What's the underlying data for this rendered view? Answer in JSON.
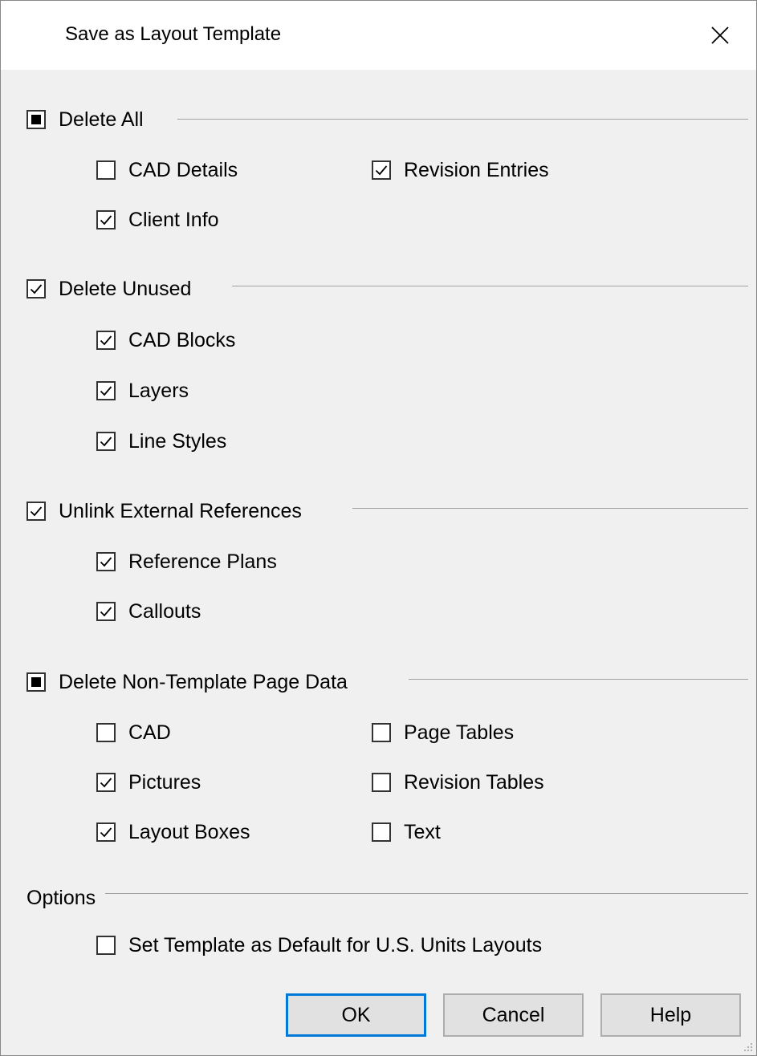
{
  "window": {
    "title": "Save as Layout Template"
  },
  "groups": {
    "delete_all": {
      "label": "Delete All",
      "state": "indeterminate",
      "items": {
        "cad_details": {
          "label": "CAD Details",
          "checked": false
        },
        "revision_entries": {
          "label": "Revision Entries",
          "checked": true
        },
        "client_info": {
          "label": "Client Info",
          "checked": true
        }
      }
    },
    "delete_unused": {
      "label": "Delete Unused",
      "state": "checked",
      "items": {
        "cad_blocks": {
          "label": "CAD Blocks",
          "checked": true
        },
        "layers": {
          "label": "Layers",
          "checked": true
        },
        "line_styles": {
          "label": "Line Styles",
          "checked": true
        }
      }
    },
    "unlink_external": {
      "label": "Unlink External References",
      "state": "checked",
      "items": {
        "reference_plans": {
          "label": "Reference Plans",
          "checked": true
        },
        "callouts": {
          "label": "Callouts",
          "checked": true
        }
      }
    },
    "delete_non_template": {
      "label": "Delete Non-Template Page Data",
      "state": "indeterminate",
      "items": {
        "cad": {
          "label": "CAD",
          "checked": false
        },
        "page_tables": {
          "label": "Page Tables",
          "checked": false
        },
        "pictures": {
          "label": "Pictures",
          "checked": true
        },
        "revision_tables": {
          "label": "Revision Tables",
          "checked": false
        },
        "layout_boxes": {
          "label": "Layout Boxes",
          "checked": true
        },
        "text": {
          "label": "Text",
          "checked": false
        }
      }
    }
  },
  "options": {
    "label": "Options",
    "set_default": {
      "label": "Set Template as Default for U.S. Units Layouts",
      "checked": false
    }
  },
  "buttons": {
    "ok": "OK",
    "cancel": "Cancel",
    "help": "Help"
  }
}
